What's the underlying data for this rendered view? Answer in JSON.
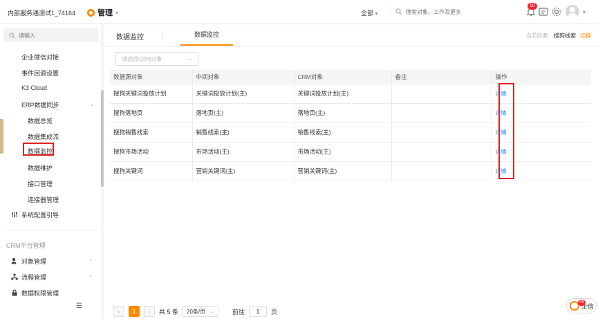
{
  "topbar": {
    "tenant": "内部服务通测试1_74164",
    "module": "管理",
    "scope": "全部",
    "search_placeholder": "搜索对象、工作及更多",
    "notification_count": "10"
  },
  "sidebar": {
    "search_placeholder": "请输入",
    "items": [
      {
        "label": "企业微信对接"
      },
      {
        "label": "事件回调设置"
      },
      {
        "label": "K3 Cloud"
      },
      {
        "label": "ERP数据同步"
      },
      {
        "label": "数据总览"
      },
      {
        "label": "数据集成流"
      },
      {
        "label": "数据监控"
      },
      {
        "label": "数据维护"
      },
      {
        "label": "接口管理"
      },
      {
        "label": "连接器管理"
      },
      {
        "label": "系统配置引导"
      }
    ],
    "section_title": "CRM平台管理",
    "crm_items": [
      {
        "label": "对象管理"
      },
      {
        "label": "流程管理"
      },
      {
        "label": "数据权限管理"
      }
    ]
  },
  "main": {
    "title": "数据监控",
    "tab": "数据监控",
    "current_label": "当前账套:",
    "current_value": "搜狗线索",
    "switch_label": "切换",
    "crm_select_placeholder": "请选择CRM对象",
    "columns": [
      "数据源对象",
      "中间对象",
      "CRM对象",
      "备注",
      "操作"
    ],
    "rows": [
      {
        "source": "搜狗关键词投放计划",
        "middle": "关键词投放计划(主)",
        "crm": "关键词投放计划(主)",
        "note": "",
        "action": "详情"
      },
      {
        "source": "搜狗落地页",
        "middle": "落地页(主)",
        "crm": "落地页(主)",
        "note": "",
        "action": "详情"
      },
      {
        "source": "搜狗销售线索",
        "middle": "销售线索(主)",
        "crm": "销售线索(主)",
        "note": "",
        "action": "详情"
      },
      {
        "source": "搜狗市场活动",
        "middle": "市场活动(主)",
        "crm": "市场活动(主)",
        "note": "",
        "action": "详情"
      },
      {
        "source": "搜狗关键词",
        "middle": "营销关键词(主)",
        "crm": "营销关键词(主)",
        "note": "",
        "action": "详情"
      }
    ],
    "pagination": {
      "current_page": "1",
      "total": "共 5 条",
      "page_size": "20条/页",
      "goto_label": "前往",
      "goto_value": "1",
      "page_suffix": "页"
    }
  },
  "qixin": {
    "label": "企信",
    "count": "99"
  },
  "colors": {
    "accent": "#ff8a00",
    "link": "#1890ff",
    "highlight_box": "#e02020"
  }
}
